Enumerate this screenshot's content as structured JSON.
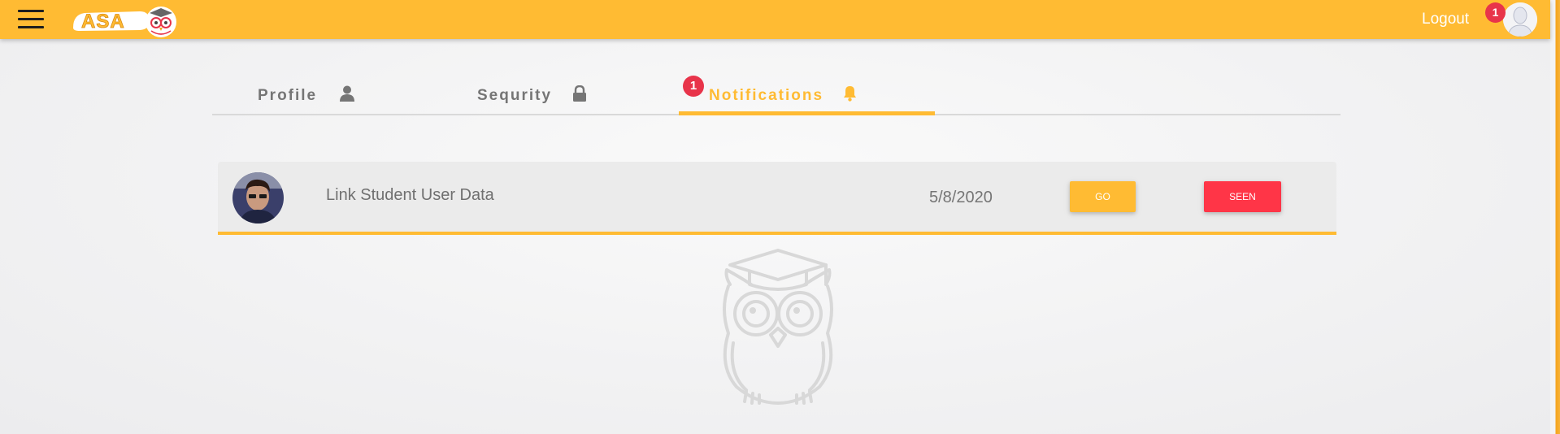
{
  "topbar": {
    "logo_text": "ASA",
    "logout_label": "Logout",
    "notification_count": "1",
    "accent_color": "#ffbb33"
  },
  "tabs": [
    {
      "label": "Profile",
      "icon": "user-icon",
      "active": false
    },
    {
      "label": "Sequrity",
      "icon": "lock-icon",
      "active": false
    },
    {
      "label": "Notifications",
      "icon": "bell-icon",
      "active": true,
      "badge": "1"
    }
  ],
  "notifications": [
    {
      "title": "Link Student User Data",
      "date": "5/8/2020",
      "go_label": "GO",
      "seen_label": "SEEN"
    }
  ],
  "colors": {
    "accent": "#ffbb33",
    "danger": "#ff3547",
    "badge": "#e8344a"
  }
}
